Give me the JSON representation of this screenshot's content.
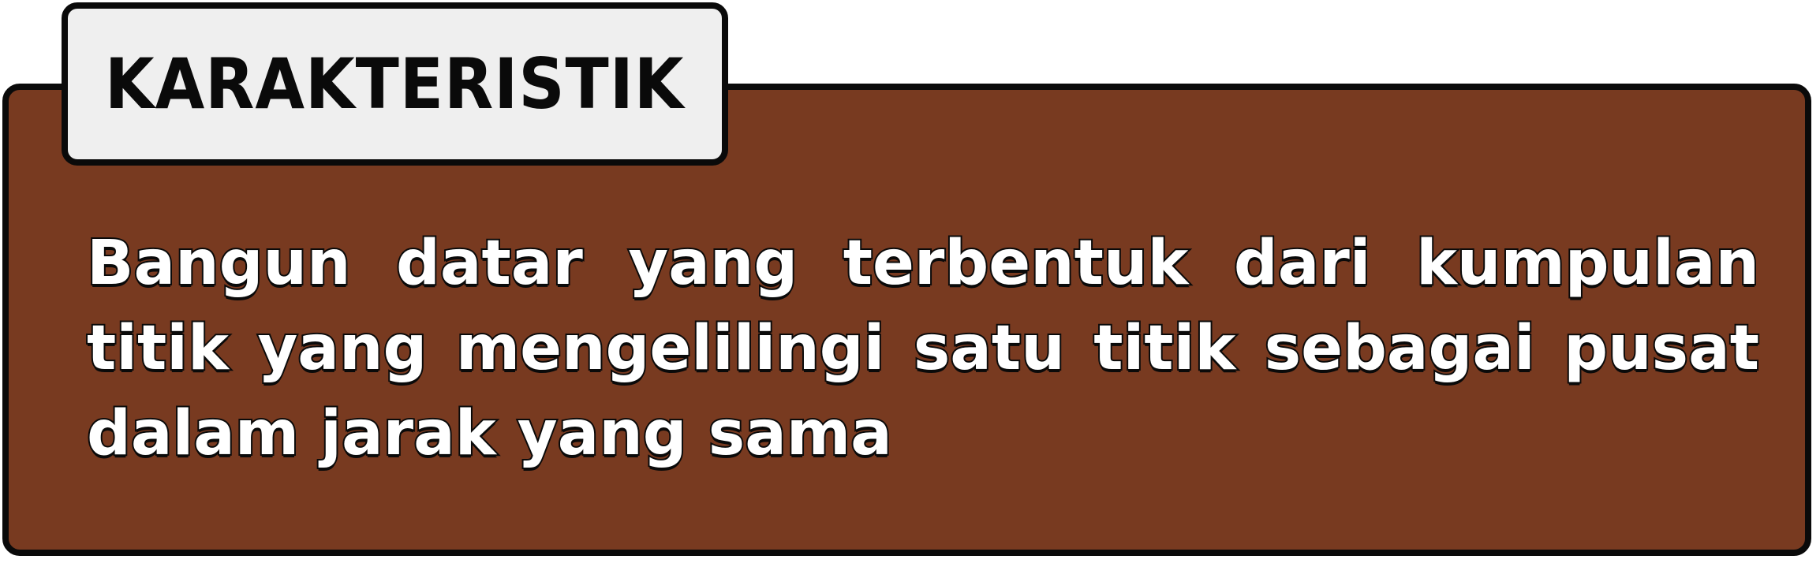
{
  "tab": {
    "title": "KARAKTERISTIK"
  },
  "content": {
    "text": "Bangun datar yang terbentuk dari kumpulan titik yang mengelilingi satu titik sebagai pusat dalam jarak yang sama"
  },
  "colors": {
    "panel_background": "#783a20",
    "tab_background": "#efefef",
    "outline": "#0a0a0a",
    "text": "#ffffff"
  }
}
